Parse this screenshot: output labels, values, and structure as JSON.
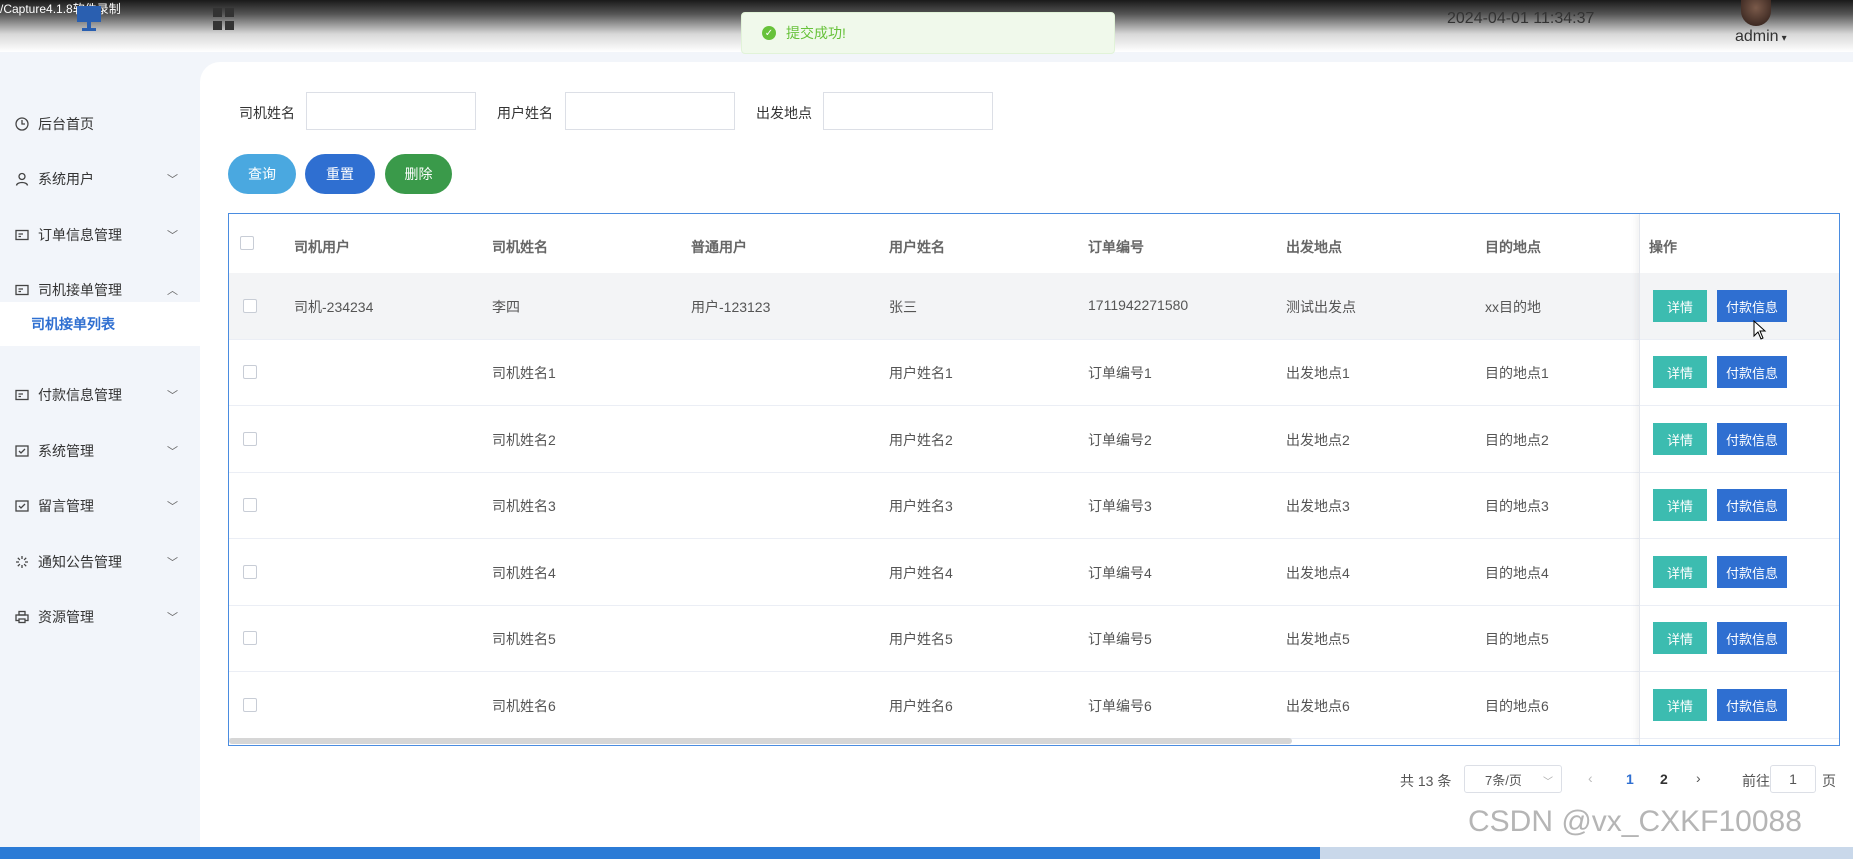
{
  "topbar": {
    "recording_label": "/Capture4.1.8软件录制",
    "datetime": "2024-04-01 11:34:37",
    "user": "admin"
  },
  "toast": {
    "message": "提交成功!"
  },
  "sidebar": {
    "items": [
      {
        "label": "后台首页",
        "icon": "clock-icon",
        "has_chevron": false
      },
      {
        "label": "系统用户",
        "icon": "user-icon",
        "has_chevron": true
      },
      {
        "label": "订单信息管理",
        "icon": "card-icon",
        "has_chevron": true
      },
      {
        "label": "司机接单管理",
        "icon": "card-icon",
        "has_chevron": true,
        "expanded": true
      },
      {
        "label": "付款信息管理",
        "icon": "card-icon",
        "has_chevron": true
      },
      {
        "label": "系统管理",
        "icon": "checkbox-icon",
        "has_chevron": true
      },
      {
        "label": "留言管理",
        "icon": "checkbox-icon",
        "has_chevron": true
      },
      {
        "label": "通知公告管理",
        "icon": "loading-icon",
        "has_chevron": true
      },
      {
        "label": "资源管理",
        "icon": "printer-icon",
        "has_chevron": true
      }
    ],
    "active_sub": "司机接单列表"
  },
  "filters": {
    "driver_name_label": "司机姓名",
    "user_name_label": "用户姓名",
    "origin_label": "出发地点",
    "driver_name_value": "",
    "user_name_value": "",
    "origin_value": ""
  },
  "actions": {
    "query": "查询",
    "reset": "重置",
    "delete": "删除"
  },
  "table": {
    "columns": [
      "司机用户",
      "司机姓名",
      "普通用户",
      "用户姓名",
      "订单编号",
      "出发地点",
      "目的地点",
      "操作"
    ],
    "rows": [
      [
        "司机-234234",
        "李四",
        "用户-123123",
        "张三",
        "1711942271580",
        "测试出发点",
        "xx目的地"
      ],
      [
        "",
        "司机姓名1",
        "",
        "用户姓名1",
        "订单编号1",
        "出发地点1",
        "目的地点1"
      ],
      [
        "",
        "司机姓名2",
        "",
        "用户姓名2",
        "订单编号2",
        "出发地点2",
        "目的地点2"
      ],
      [
        "",
        "司机姓名3",
        "",
        "用户姓名3",
        "订单编号3",
        "出发地点3",
        "目的地点3"
      ],
      [
        "",
        "司机姓名4",
        "",
        "用户姓名4",
        "订单编号4",
        "出发地点4",
        "目的地点4"
      ],
      [
        "",
        "司机姓名5",
        "",
        "用户姓名5",
        "订单编号5",
        "出发地点5",
        "目的地点5"
      ],
      [
        "",
        "司机姓名6",
        "",
        "用户姓名6",
        "订单编号6",
        "出发地点6",
        "目的地点6"
      ]
    ],
    "detail_label": "详情",
    "pay_label": "付款信息"
  },
  "pagination": {
    "total": "共 13 条",
    "page_size": "7条/页",
    "pages": [
      "1",
      "2"
    ],
    "current_page": "1",
    "goto_label": "前往",
    "goto_value": "1",
    "page_unit": "页"
  },
  "watermark": "CSDN @vx_CXKF10088",
  "colors": {
    "primary": "#2f6fd1",
    "query_button": "#4aa8e0",
    "delete_button": "#3a9a4a",
    "detail_button": "#3cbcb0",
    "success": "#67c23a"
  }
}
